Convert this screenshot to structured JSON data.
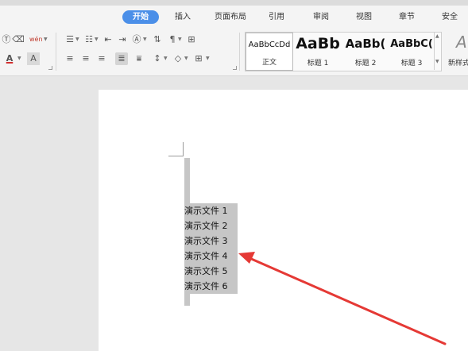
{
  "menu": {
    "tabs": [
      "开始",
      "插入",
      "页面布局",
      "引用",
      "审阅",
      "视图",
      "章节",
      "安全"
    ],
    "active_tab": "开始",
    "active_color": "#4b8fe8"
  },
  "ribbon": {
    "phonetic_glyph": "wén",
    "font_color_glyph": "A",
    "highlight_glyph": "A",
    "font_color_accent": "#d32f2f",
    "styles": [
      {
        "sample": "AaBbCcDd",
        "name": "正文"
      },
      {
        "sample": "AaBb",
        "name": "标题 1"
      },
      {
        "sample": "AaBb(",
        "name": "标题 2"
      },
      {
        "sample": "AaBbC(",
        "name": "标题 3"
      }
    ],
    "new_style_label": "新样式"
  },
  "document": {
    "lines": [
      "演示文件 1",
      "演示文件 2",
      "演示文件 3",
      "演示文件 4",
      "演示文件 5",
      "演示文件 6"
    ],
    "selection_color": "#c6c6c6",
    "arrow_color": "#e53935"
  }
}
